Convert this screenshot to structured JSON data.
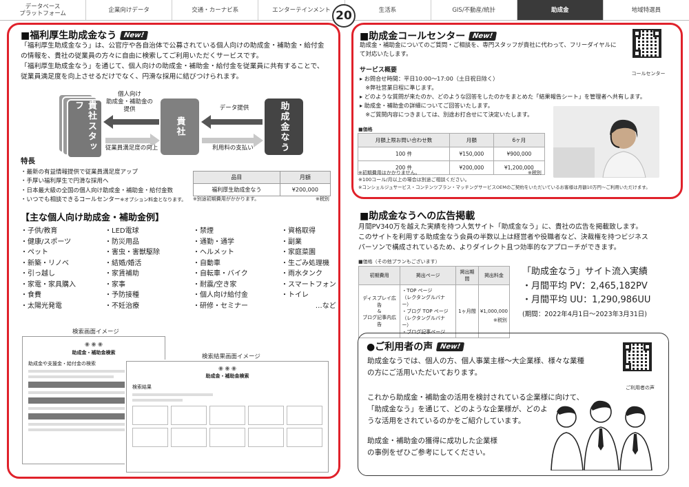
{
  "nav": {
    "items": [
      {
        "label": "データベース\nプラットフォーム",
        "active": false
      },
      {
        "label": "企業向けデータ",
        "active": false
      },
      {
        "label": "交通・カーナビ系",
        "active": false
      },
      {
        "label": "エンターテインメント",
        "active": false
      },
      {
        "label": "生活系",
        "active": false
      },
      {
        "label": "GIS/不動産/統計",
        "active": false
      },
      {
        "label": "助成金",
        "active": true
      },
      {
        "label": "地域特選員",
        "active": false
      }
    ],
    "page_number": "20"
  },
  "welfare": {
    "title": "■福利厚生助成金なう",
    "new_badge": "New!",
    "desc1": "「福利厚生助成金なう」は、公官庁や各自治体で公募されている個人向けの助成金・補助金・給付金",
    "desc2": "の情報を、貴社の従業員の方々に自由に検索してご利用いただくサービスです。",
    "desc3": "「福利厚生助成金なう」を通じて、個人向けの助成金・補助金・給付金を従業員に共有することで、",
    "desc4": "従業員満足度を向上させるだけでなく、円滑な採用に結びつけられます。",
    "diagram": {
      "staff": "貴社スタッフ",
      "company": "貴社",
      "service": "助成金なう",
      "label_top_left": "個人向け\n助成金・補助金の\n提供",
      "label_bottom_left": "従業員満足度の向上",
      "label_top_right": "データ提供",
      "label_bottom_right": "利用料の支払い"
    },
    "features_title": "特長",
    "features": [
      "・最新の有益情報提供で従業員満足度アップ",
      "・手厚い福利厚生で円滑な採用へ",
      "・日本最大級の全国の個人向け助成金・補助金・給付金数",
      "・いつでも相談できるコールセンター"
    ],
    "features_note": "※オプション料金となります。",
    "price_table": {
      "headers": [
        "品目",
        "月額"
      ],
      "rows": [
        [
          "福利厚生助成金なう",
          "¥200,000"
        ]
      ]
    },
    "price_note_left": "※別途初期費用がかかります。",
    "price_note_right": "※税別"
  },
  "examples": {
    "title": "【主な個人向け助成金・補助金例】",
    "col1": [
      "・子供/教育",
      "・健康/スポーツ",
      "・ペット",
      "・新築・リノベ",
      "・引っ越し",
      "・家電・家具購入",
      "・食費",
      "・太陽光発電"
    ],
    "col2": [
      "・LED電球",
      "・防災用品",
      "・害虫・害獣駆除",
      "・結婚/婚活",
      "・家賃補助",
      "・家事",
      "・予防接種",
      "・不妊治療"
    ],
    "col3": [
      "・禁煙",
      "・通勤・通学",
      "・ヘルメット",
      "・自動車",
      "・自転車・バイク",
      "・耐震/空き家",
      "・個人向け給付金",
      "・研修・セミナー"
    ],
    "col4": [
      "・資格取得",
      "・副業",
      "・家庭菜園",
      "・生ごみ処理機",
      "・雨水タンク",
      "・スマートフォン",
      "・トイレ",
      "…など"
    ]
  },
  "screens": {
    "search_caption": "検索画面イメージ",
    "results_caption": "検索結果画面イメージ",
    "search_heading": "助成金・補助金検索",
    "search_sub": "助成金や支援金・給付金の検索",
    "results_heading": "助成金・補助金検索",
    "results_sub": "検索結果"
  },
  "callcenter": {
    "title": "■助成金コールセンター",
    "new_badge": "New!",
    "desc1": "助成金・補助金についてのご質問・ご相談を、専門スタッフが貴社に代わって、フリーダイヤルに",
    "desc2": "て対応いたします。",
    "overview_title": "サービス概要",
    "items": [
      "▸ お問合せ時間：平日10:00〜17:00（土日祝日除く）",
      "　※弊社営業日程に準じます。",
      "▸ どのような質問が来たのか、どのような回答をしたのかをまとめた「結果報告シート」を管理者へ共有します。",
      "▸ 助成金・補助金の詳細についてご回答いたします。",
      "　※ご質問内容につきましては、別途お打合せにて決定いたします。"
    ],
    "price_title": "■価格",
    "price_table": {
      "headers": [
        "月額上限お問い合わせ数",
        "月額",
        "6ヶ月"
      ],
      "rows": [
        [
          "100 件",
          "¥150,000",
          "¥900,000"
        ],
        [
          "200 件",
          "¥200,000",
          "¥1,200,000"
        ]
      ]
    },
    "notes": [
      "※初期費用はかかりません。",
      "※100コール/月以上の場合は別途ご相談ください。",
      "※コンシェルジュサービス・コンテンツプラン・マッチングサービスOEMのご契約をいただいているお客様は月額10万円〜ご利用いただけます。"
    ],
    "tax_note": "※税別",
    "qr_label": "コールセンター"
  },
  "advert": {
    "title": "■助成金なうへの広告掲載",
    "desc1": "月間PV340万を越えた実績を持つ人気サイト「助成金なう」に、貴社の広告を掲載致します。",
    "desc2": "このサイトを利用する助成金なう会員の半数以上は経営者や役職者など、決裁権を持つビジネス",
    "desc3": "パーソンで構成されているため、よりダイレクト且つ効率的なアプローチができます。",
    "price_title": "■価格（その他プランもございます）",
    "table": {
      "headers": [
        "初期費用",
        "掲出ページ",
        "掲出期間",
        "掲出料金"
      ],
      "row": {
        "type": "ディスプレイ広告\n&\nブログ記事内広告",
        "pages": "・TOP ページ\n（レクタングルバナー）\n・ブログ TOP ページ\n（レクタングルバナー）\n・ブログ記事ページ",
        "period": "1ヶ月間",
        "price": "¥1,000,000"
      }
    },
    "tax_note": "※税別",
    "stats_title": "「助成金なう」サイト流入実績",
    "stats_pv": "・月間平均 PV：2,465,182PV",
    "stats_uu": "・月間平均 UU：1,290,986UU",
    "stats_period": "(期間：2022年4月1日〜2023年3月31日)"
  },
  "voice": {
    "title": "●ご利用者の声",
    "new_badge": "New!",
    "p1": "助成金なうでは、個人の方、個人事業主様〜大企業様、様々な業種",
    "p2": "の方にご活用いただいております。",
    "p3": "これから助成金・補助金の活用を検討されている企業様に向けて、",
    "p4": "「助成金なう」を通じて、どのような企業様が、どのよ",
    "p5": "うな活用をされているのかをご紹介しています。",
    "p6": "助成金・補助金の獲得に成功した企業様",
    "p7": "の事例をぜひご参考にしてください。",
    "qr_label": "ご利用者の声"
  }
}
